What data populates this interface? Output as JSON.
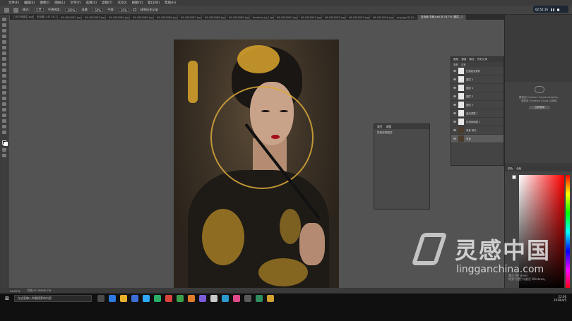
{
  "menubar": {
    "items": [
      "文件(F)",
      "编辑(E)",
      "图像(I)",
      "图层(L)",
      "文字(Y)",
      "选择(S)",
      "滤镜(T)",
      "3D(D)",
      "视图(V)",
      "窗口(W)",
      "帮助(H)"
    ]
  },
  "options": {
    "mode_label": "模式:",
    "mode_value": "正常",
    "opacity_label": "不透明度:",
    "opacity_value": "100%",
    "flow_label": "流量:",
    "flow_value": "60%",
    "smooth_label": "平滑:",
    "smooth_value": "10%",
    "erase_label": "抹到历史记录"
  },
  "tabs": [
    "工作中的图层.psd",
    "未标题-1 @ 16.7...",
    "98.1600082.jpg",
    "98.1600083.jpg",
    "98.1600084.jpg",
    "98.1600085.jpg",
    "98.1600086.jpg",
    "98.1600087.jpg",
    "98.1600088.jpg",
    "98.1600089.jpg",
    "timeline_bj_1.jpg",
    "98.1600090.jpg",
    "98.1600091.jpg",
    "98.1600092.jpg",
    "98.1600093.jpg",
    "98.1600094.jpg",
    "png.jpg @ 10...",
    "金色扇-去扇.psd @ 16.7% (图层...)"
  ],
  "recorder": {
    "time": "02:52:16"
  },
  "properties": {
    "tab1": "属性",
    "tab2": "调整",
    "title": "智能滤镜图层"
  },
  "layers": {
    "tabs": [
      "图层",
      "通道",
      "路径",
      "历史记录"
    ],
    "kind_label": "类型",
    "blend": "正常",
    "items": [
      {
        "name": "扫描纸张素材",
        "type": "light"
      },
      {
        "name": "图层 5",
        "type": "light"
      },
      {
        "name": "图层 4",
        "type": "light"
      },
      {
        "name": "图层 3",
        "type": "light"
      },
      {
        "name": "图层 2",
        "type": "light"
      },
      {
        "name": "曲线调整 1",
        "type": "light"
      },
      {
        "name": "色相饱和度 1",
        "type": "light"
      },
      {
        "name": "背景 拷贝",
        "type": "dark"
      },
      {
        "name": "背景",
        "type": "dark",
        "selected": true
      }
    ]
  },
  "libraries": {
    "line1": "要使用 Creative Cloud Libraries,",
    "line2": "请登录 Creative Cloud 以使用",
    "button": "立即登录"
  },
  "color": {
    "tab1": "颜色",
    "tab2": "色板"
  },
  "statusbar": {
    "zoom": "16.67%",
    "doc": "文档:51.3M/95.7M"
  },
  "taskbar": {
    "search_placeholder": "在这里输入你要搜索的内容",
    "time": "22:06",
    "date": "2019/4/5"
  },
  "watermark": {
    "cn": "灵感中国",
    "en": "lingganchina.com"
  },
  "activation": {
    "line1": "激活 Windows",
    "line2": "转到\"设置\"以激活 Windows。"
  }
}
